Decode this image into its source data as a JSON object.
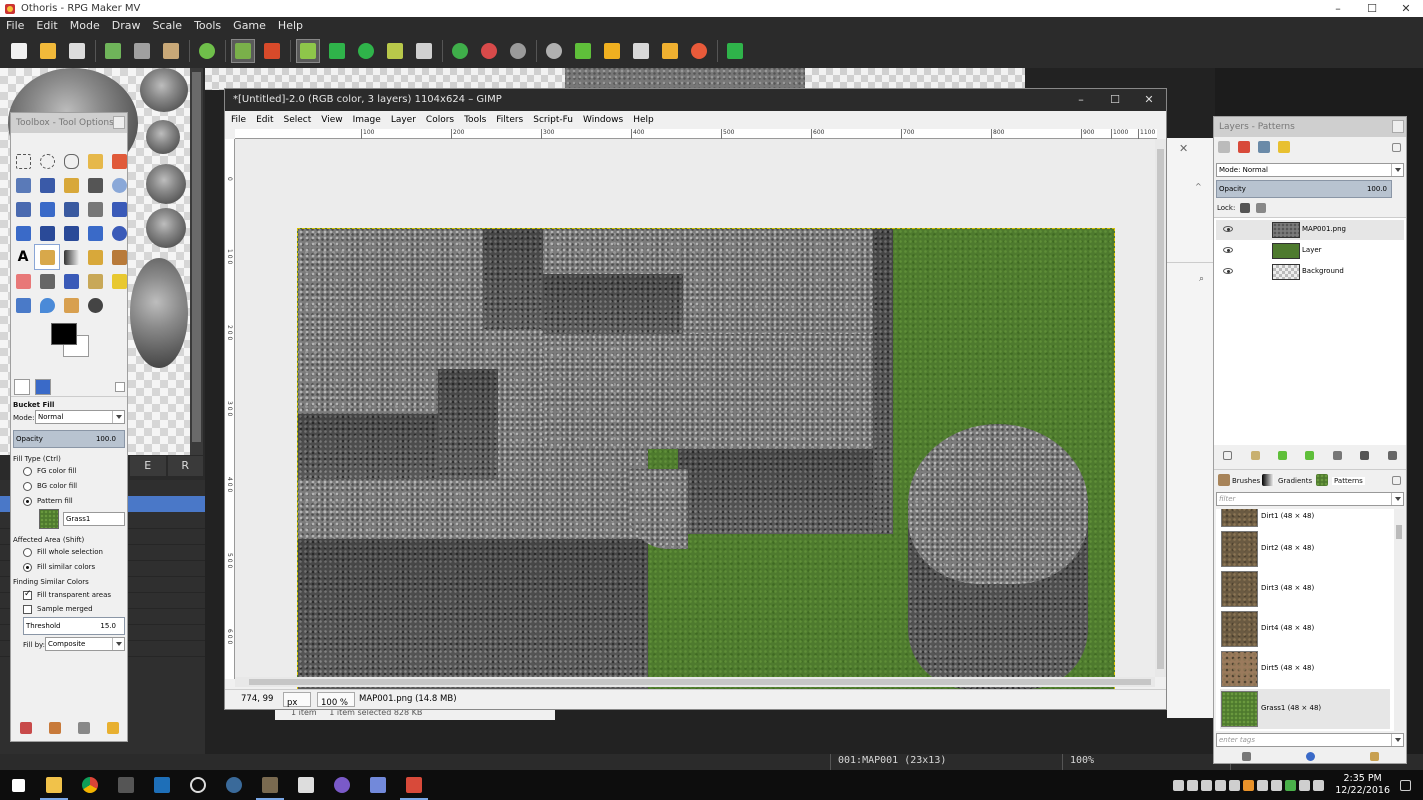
{
  "rpgmaker": {
    "title": "Othoris - RPG Maker MV",
    "menu": [
      "File",
      "Edit",
      "Mode",
      "Draw",
      "Scale",
      "Tools",
      "Game",
      "Help"
    ],
    "tileset_tabs": [
      "E",
      "R"
    ],
    "status": {
      "map": "001:MAP001 (23x13)",
      "zoom": "100%"
    }
  },
  "background_explorer": {
    "items": "1 item",
    "selected": "1 item selected  828 KB"
  },
  "gimp_image": {
    "title": "*[Untitled]-2.0 (RGB color, 3 layers) 1104x624 – GIMP",
    "menu": [
      "File",
      "Edit",
      "Select",
      "View",
      "Image",
      "Layer",
      "Colors",
      "Tools",
      "Filters",
      "Script-Fu",
      "Windows",
      "Help"
    ],
    "ruler_h": [
      "100",
      "200",
      "300",
      "400",
      "500",
      "600",
      "700",
      "800",
      "900",
      "1000",
      "1100"
    ],
    "ruler_v": [
      "0",
      "1 0 0",
      "2 0 0",
      "3 0 0",
      "4 0 0",
      "5 0 0",
      "6 0 0"
    ],
    "status": {
      "coords": "774, 99",
      "unit": "px",
      "zoom": "100 %",
      "file": "MAP001.png (14.8 MB)"
    }
  },
  "gimp_toolbox": {
    "title": "Toolbox - Tool Options",
    "tool_name": "Bucket Fill",
    "mode_label": "Mode:",
    "mode_value": "Normal",
    "opacity_label": "Opacity",
    "opacity_value": "100.0",
    "fill_type_label": "Fill Type  (Ctrl)",
    "fill_options": [
      "FG color fill",
      "BG color fill",
      "Pattern fill"
    ],
    "pattern_name": "Grass1",
    "affected_label": "Affected Area  (Shift)",
    "affected_options": [
      "Fill whole selection",
      "Fill similar colors"
    ],
    "finding_label": "Finding Similar Colors",
    "fill_transparent": "Fill transparent areas",
    "sample_merged": "Sample merged",
    "threshold_label": "Threshold",
    "threshold_value": "15.0",
    "fillby_label": "Fill by:",
    "fillby_value": "Composite"
  },
  "gimp_layers": {
    "title": "Layers - Patterns",
    "mode": "Mode: Normal",
    "opacity_label": "Opacity",
    "opacity_value": "100.0",
    "lock_label": "Lock:",
    "layers": [
      "MAP001.png",
      "Layer",
      "Background"
    ],
    "tabs": [
      "Brushes",
      "Gradients",
      "Patterns"
    ],
    "filter_placeholder": "filter",
    "partial_pattern": "Dirt1 (48 × 48)",
    "patterns": [
      "Dirt2 (48 × 48)",
      "Dirt3 (48 × 48)",
      "Dirt4 (48 × 48)",
      "Dirt5 (48 × 48)",
      "Grass1 (48 × 48)"
    ],
    "tags_placeholder": "enter tags"
  },
  "taskbar": {
    "time": "2:35 PM",
    "date": "12/22/2016"
  },
  "colors": {
    "accent": "#4a78c8",
    "grass": "#4e7a2e",
    "stone": "#7c7c7c",
    "selection": "#d8c000"
  }
}
